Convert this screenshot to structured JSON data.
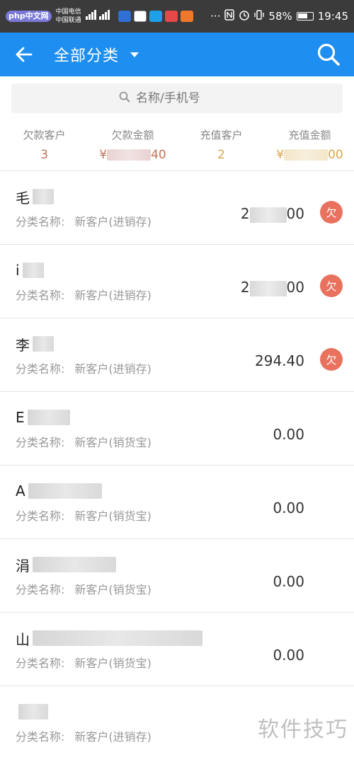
{
  "status_bar": {
    "site_logo": "php中文网",
    "carrier1": "中国电信",
    "carrier2": "中国联通",
    "battery": "58%",
    "time": "19:45"
  },
  "app_bar": {
    "title": "全部分类"
  },
  "search": {
    "placeholder": "名称/手机号"
  },
  "stats": [
    {
      "label": "欠款客户",
      "value": "3"
    },
    {
      "label": "欠款金额",
      "prefix": "¥",
      "suffix": "40"
    },
    {
      "label": "充值客户",
      "value": "2"
    },
    {
      "label": "充值金额",
      "prefix": "¥",
      "suffix": "00"
    }
  ],
  "customers": [
    {
      "initial": "毛",
      "label": "分类名称:",
      "category": "新客户(进销存)",
      "amount_prefix": "2",
      "amount_suffix": "00",
      "owe": "欠"
    },
    {
      "initial": "i",
      "label": "分类名称:",
      "category": "新客户(进销存)",
      "amount_prefix": "2",
      "amount_suffix": "00",
      "owe": "欠"
    },
    {
      "initial": "李",
      "label": "分类名称:",
      "category": "新客户(进销存)",
      "amount": "294.40",
      "owe": "欠"
    },
    {
      "initial": "E",
      "label": "分类名称:",
      "category": "新客户(销货宝)",
      "amount": "0.00"
    },
    {
      "initial": "A",
      "label": "分类名称:",
      "category": "新客户(销货宝)",
      "amount": "0.00"
    },
    {
      "initial": "涓",
      "label": "分类名称:",
      "category": "新客户(销货宝)",
      "amount": "0.00"
    },
    {
      "initial": "山",
      "label": "分类名称:",
      "category": "新客户(销货宝)",
      "amount": "0.00"
    },
    {
      "initial": "",
      "label": "分类名称:",
      "category": "新客户(进销存)",
      "amount": ""
    }
  ],
  "watermark": "软件技巧"
}
